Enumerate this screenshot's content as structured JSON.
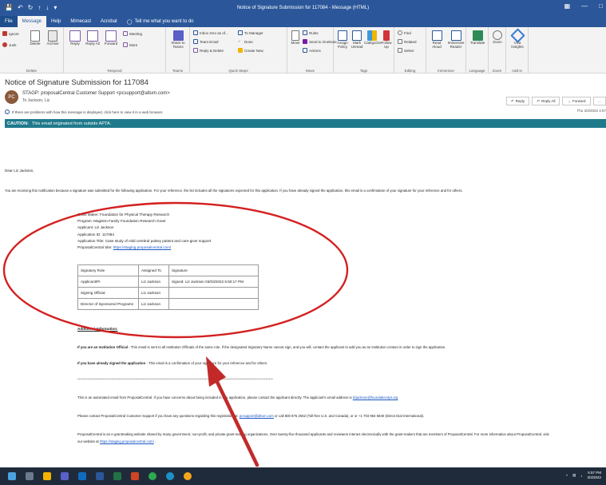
{
  "window": {
    "title": "Notice of Signature Submission for 117084 - Message (HTML)"
  },
  "menu": {
    "tabs": [
      "File",
      "Message",
      "Help",
      "Mimecast",
      "Acrobat"
    ],
    "tell_me": "Tell me what you want to do"
  },
  "ribbon": {
    "delete_group": {
      "label": "Delete",
      "ignore": "Ignore",
      "junk": "Junk",
      "delete": "Delete",
      "archive": "Archive"
    },
    "respond_group": {
      "label": "Respond",
      "reply": "Reply",
      "reply_all": "Reply All",
      "forward": "Forward",
      "meeting": "Meeting",
      "more": "More"
    },
    "teams_group": {
      "label": "Teams",
      "share": "Share to Teams"
    },
    "quicksteps_group": {
      "label": "Quick Steps",
      "inbox_zero": "Inbox zero as of...",
      "team_email": "Team Email",
      "reply_delete": "Reply & Delete",
      "to_manager": "To Manager",
      "done": "Done",
      "create_new": "Create New"
    },
    "move_group": {
      "label": "Move",
      "move": "Move",
      "rules": "Rules",
      "onenote": "Send to OneNote",
      "actions": "Actions"
    },
    "tags_group": {
      "label": "Tags",
      "assign_policy": "Assign Policy",
      "mark_unread": "Mark Unread",
      "categorize": "Categorize",
      "follow_up": "Follow Up"
    },
    "editing_group": {
      "label": "Editing",
      "find": "Find",
      "related": "Related",
      "select": "Select"
    },
    "immersive_group": {
      "label": "Immersive",
      "read_aloud": "Read Aloud",
      "immersive_reader": "Immersive Reader"
    },
    "language_group": {
      "label": "Language",
      "translate": "Translate"
    },
    "zoom_group": {
      "label": "Zoom",
      "zoom": "Zoom"
    },
    "addin_group": {
      "label": "Add-in",
      "viva": "Viva Insights"
    }
  },
  "message": {
    "subject": "Notice of Signature Submission for 117084",
    "avatar_initials": "PC",
    "sender": "STAGP: proposalCentral Customer Support <pcsupport@altum.com>",
    "to": "To  Jackson, Liz",
    "info_bar": "If there are problems with how this message is displayed, click here to view it in a web browser.",
    "reply": "Reply",
    "reply_all": "Reply All",
    "forward": "Forward",
    "date": "Thu 3/3/2022 4:57"
  },
  "caution": {
    "label": "CAUTION:",
    "text": "This email originated from outside APTA."
  },
  "body": {
    "greeting": "Dear Liz Jackson,",
    "intro": "You are receiving this notification because a signature was submitted for the following application. For your reference, the list includes all the signatures expected for this application. If you have already signed the application, this email is a confirmation of your signature for your reference and for others.",
    "grant_maker": "Grant Maker: Foundation for Physical Therapy Research",
    "program": "Program: Magistro Family Foundation Research Grant",
    "applicant": "Applicant: Liz Jackson",
    "application_id": "Application ID: 117084",
    "application_title": "Application Title: Case study of mild cerebral palsey patient and care-giver support",
    "site_label": "ProposalCentral Site: ",
    "site_url": "https://staging.proposalcentral.com/",
    "additional_info": "Additional Information:",
    "inst_bold": "If you are an Institution Official",
    "inst_text": " - This email is sent to all Institution Officials of the same role. If the designated Signatory Name cannot sign, and you will, contact the applicant to add you as an Institution contact in order to sign the application.",
    "signed_bold": "If you have already signed the application",
    "signed_text": " - This email is a confirmation of your signature for your reference and for others.",
    "stars": "************************************************************************************************************************************",
    "auto_text": "This is an automated email from ProposalCentral. If you have concerns about being included in this application, please contact the applicant directly. The applicant's email address is ",
    "auto_email": "lizjackson@foundation4pt.org",
    "contact_text": "Please contact ProposalCentral Customer Support if you have any questions regarding this registration at: ",
    "contact_email": "pcsupport@altum.com",
    "contact_phone": " or call 800 875 2562 (Toll-free U.S. and Canada), or or +1 703 964 5840 (Direct Dial International).",
    "about_text": "ProposalCentral is an e-grantmaking website shared by many government, non-profit, and private grant-making organizations. Over twenty-five thousand applicants and reviewers interact electronically with the grant-makers that are members of ProposalCentral. For more information about ProposalCentral, visit",
    "website_prefix": "our website at ",
    "website_url": "https://staging.proposalcentral.com/",
    "website_suffix": " ."
  },
  "signature_table": {
    "headers": [
      "Signatory Role",
      "Assigned To",
      "Signature"
    ],
    "rows": [
      [
        "Applicant/PI",
        "Liz Jackson",
        "Signed: Liz Jackson 03/03/2022 5:50:17 PM"
      ],
      [
        "Signing Official",
        "Liz Jackson",
        ""
      ],
      [
        "Director of Sponsored Programs",
        "Liz Jackson",
        ""
      ]
    ]
  },
  "taskbar": {
    "time": "5:57 PM",
    "date": "3/3/2022"
  },
  "colors": {
    "titlebar": "#2b579a",
    "caution": "#1f7a8c",
    "annotation": "#d42020",
    "link": "#1a56c4"
  }
}
